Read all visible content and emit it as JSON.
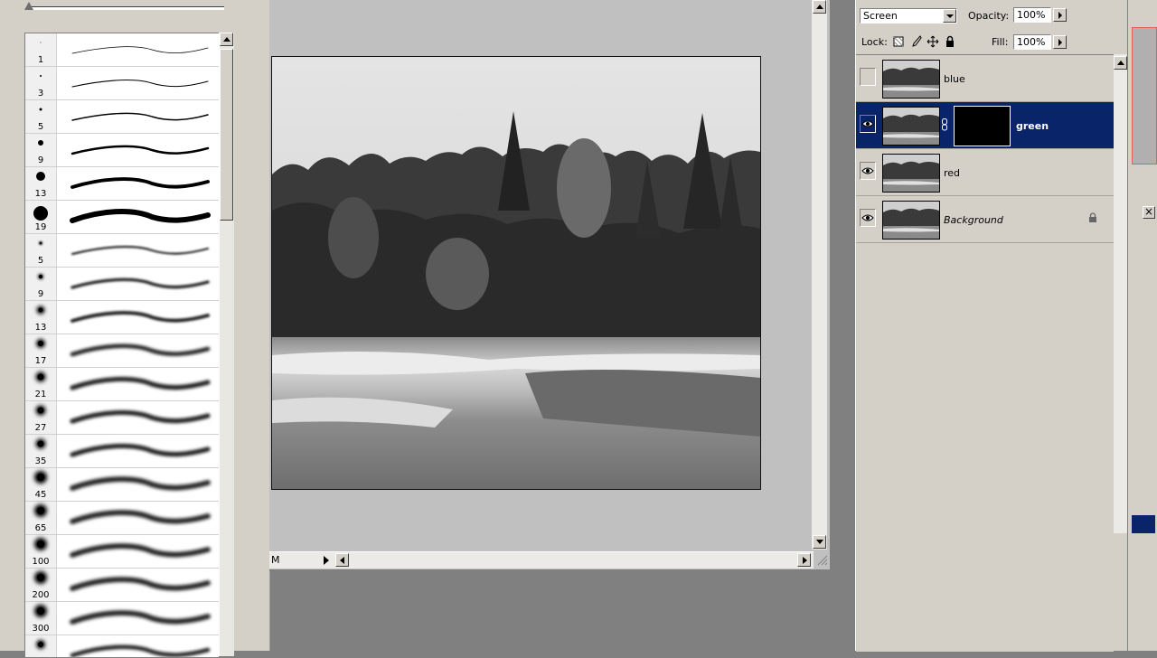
{
  "brushes": {
    "items": [
      {
        "size": "1",
        "kind": "hard",
        "dot": 1
      },
      {
        "size": "3",
        "kind": "hard",
        "dot": 2
      },
      {
        "size": "5",
        "kind": "hard",
        "dot": 3
      },
      {
        "size": "9",
        "kind": "hard",
        "dot": 6
      },
      {
        "size": "13",
        "kind": "hard",
        "dot": 10
      },
      {
        "size": "19",
        "kind": "hard",
        "dot": 16
      },
      {
        "size": "5",
        "kind": "soft",
        "dot": 2
      },
      {
        "size": "9",
        "kind": "soft",
        "dot": 4
      },
      {
        "size": "13",
        "kind": "soft",
        "dot": 5
      },
      {
        "size": "17",
        "kind": "soft",
        "dot": 6
      },
      {
        "size": "21",
        "kind": "soft",
        "dot": 7
      },
      {
        "size": "27",
        "kind": "soft",
        "dot": 7
      },
      {
        "size": "35",
        "kind": "soft",
        "dot": 7
      },
      {
        "size": "45",
        "kind": "soft",
        "dot": 8
      },
      {
        "size": "65",
        "kind": "soft",
        "dot": 8
      },
      {
        "size": "100",
        "kind": "soft",
        "dot": 8
      },
      {
        "size": "200",
        "kind": "soft",
        "dot": 8
      },
      {
        "size": "300",
        "kind": "soft",
        "dot": 8
      },
      {
        "size": "",
        "kind": "soft",
        "dot": 6
      }
    ]
  },
  "document": {
    "zoom_fragment": "M"
  },
  "layers": {
    "blend_mode": "Screen",
    "opacity_label": "Opacity:",
    "opacity_value": "100%",
    "lock_label": "Lock:",
    "fill_label": "Fill:",
    "fill_value": "100%",
    "items": [
      {
        "name": "blue",
        "visible": false,
        "selected": false,
        "has_mask": false,
        "locked": false,
        "italic": false
      },
      {
        "name": "green",
        "visible": true,
        "selected": true,
        "has_mask": true,
        "locked": false,
        "italic": false
      },
      {
        "name": "red",
        "visible": true,
        "selected": false,
        "has_mask": false,
        "locked": false,
        "italic": false
      },
      {
        "name": "Background",
        "visible": true,
        "selected": false,
        "has_mask": false,
        "locked": true,
        "italic": true
      }
    ]
  },
  "colors": {
    "panel_bg": "#d4d0c8",
    "selection": "#0a246a",
    "workspace": "#808080",
    "doc_bg": "#c0c0c0"
  },
  "icons": [
    "eye-icon",
    "lock-icon",
    "link-icon",
    "lock-transparent-icon",
    "lock-brush-icon",
    "lock-move-icon",
    "arrow-up-icon",
    "arrow-down-icon"
  ]
}
